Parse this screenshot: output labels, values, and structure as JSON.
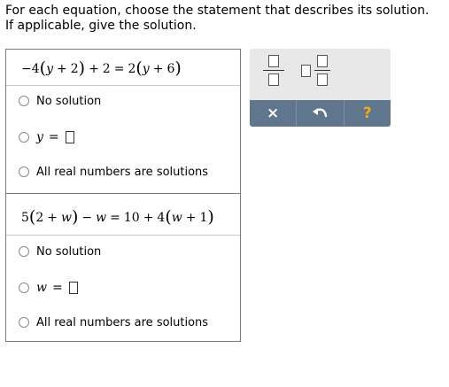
{
  "instructions": {
    "line1": "For each equation, choose the statement that describes its solution.",
    "line2": "If applicable, give the solution."
  },
  "problems": [
    {
      "equation": {
        "t1": "−4",
        "t2": "(",
        "t3": "y",
        "t4": "+",
        "t5": "2",
        "t6": ")",
        "t7": "+",
        "t8": "2",
        "t9": "=",
        "t10": "2",
        "t11": "(",
        "t12": "y",
        "t13": "+",
        "t14": "6",
        "t15": ")"
      },
      "options": {
        "no_solution": "No solution",
        "variable": "y",
        "equals": "=",
        "all_real": "All real numbers are solutions"
      }
    },
    {
      "equation": {
        "t1": "5",
        "t2": "(",
        "t3": "2",
        "t4": "+",
        "t5": "w",
        "t6": ")",
        "t7": "−",
        "t8": "w",
        "t9": "=",
        "t10": "10",
        "t11": "+",
        "t12": "4",
        "t13": "(",
        "t14": "w",
        "t15": "+",
        "t16": "1",
        "t17": ")"
      },
      "options": {
        "no_solution": "No solution",
        "variable": "w",
        "equals": "=",
        "all_real": "All real numbers are solutions"
      }
    }
  ],
  "toolbar": {
    "buttons": {
      "fraction": "fraction-icon",
      "mixed_number": "mixed-number-icon",
      "clear": "×",
      "undo": "undo-icon",
      "help": "?"
    },
    "colors": {
      "bar": "#5f768c",
      "panel": "#e8e8e8",
      "help": "#f5a623"
    }
  }
}
